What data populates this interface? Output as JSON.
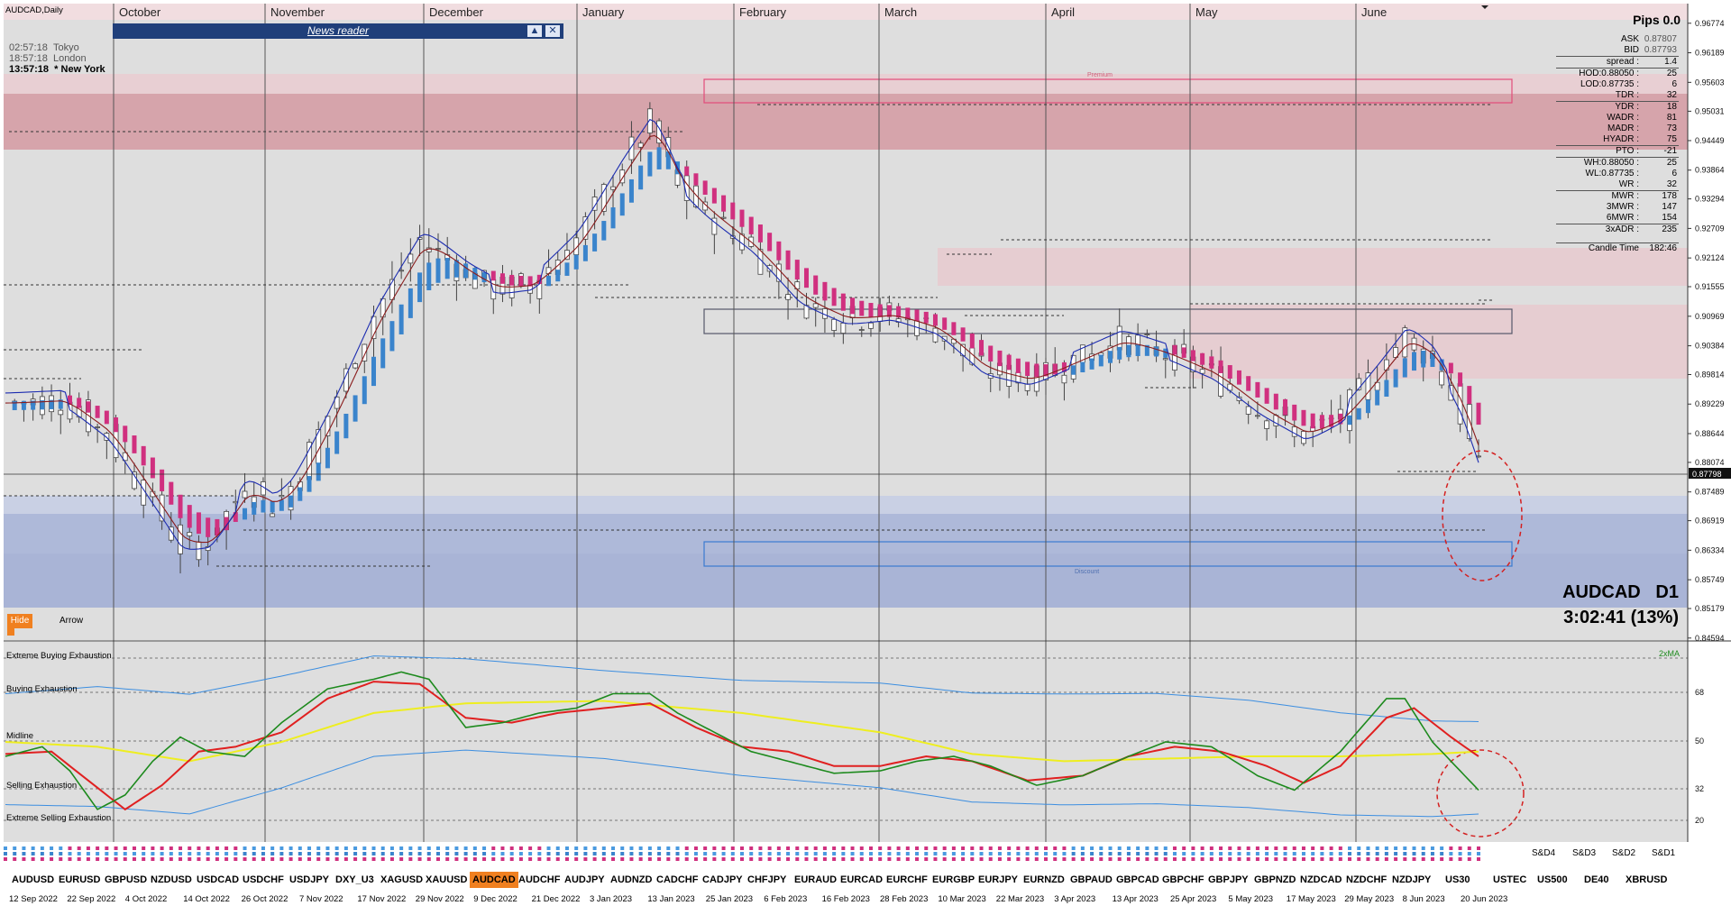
{
  "window": {
    "title": "AUDCAD,Daily"
  },
  "months": [
    "October",
    "November",
    "December",
    "January",
    "February",
    "March",
    "April",
    "May",
    "June"
  ],
  "news_reader": {
    "title": "News reader"
  },
  "clocks": [
    {
      "time": "02:57:18",
      "city": "Tokyo"
    },
    {
      "time": "18:57:18",
      "city": "London"
    },
    {
      "time": "13:57:18",
      "city": "* New York"
    }
  ],
  "info": {
    "pips": "Pips 0.0",
    "rows": [
      {
        "label": "ASK",
        "value": "0.87807"
      },
      {
        "label": "BID",
        "value": "0.87793"
      },
      {
        "label": "spread :",
        "value": "1.4"
      },
      {
        "label": "HOD:0.88050 :",
        "value": "25"
      },
      {
        "label": "LOD:0.87735 :",
        "value": "6"
      },
      {
        "label": "TDR :",
        "value": "32"
      },
      {
        "label": "YDR :",
        "value": "18"
      },
      {
        "label": "WADR :",
        "value": "81"
      },
      {
        "label": "MADR :",
        "value": "73"
      },
      {
        "label": "HYADR :",
        "value": "75"
      },
      {
        "label": "PTO :",
        "value": "-21"
      },
      {
        "label": "WH:0.88050 :",
        "value": "25"
      },
      {
        "label": "WL:0.87735 :",
        "value": "6"
      },
      {
        "label": "WR :",
        "value": "32"
      },
      {
        "label": "MWR :",
        "value": "178"
      },
      {
        "label": "3MWR :",
        "value": "147"
      },
      {
        "label": "6MWR :",
        "value": "154"
      },
      {
        "label": "3xADR :",
        "value": "235"
      },
      {
        "label": "Candle Time",
        "value": "182:46"
      }
    ]
  },
  "symbol_title": "AUDCAD   D1",
  "timer": "3:02:41 (13%)",
  "zone_labels": {
    "premium": "Premium",
    "discount": "Discount"
  },
  "controls": {
    "hide": "Hide",
    "arrow": "Arrow"
  },
  "indicator": {
    "labels": [
      "Extreme Buying Exhaustion",
      "Buying Exhaustion",
      "Midline",
      "Selling Exhaustion",
      "Extreme Selling Exhaustion"
    ],
    "tag": "2xMA",
    "levels": [
      "68",
      "50",
      "32",
      "20"
    ]
  },
  "strength_labels": [
    "S&D4",
    "S&D3",
    "S&D2",
    "S&D1"
  ],
  "symbols": [
    "AUDUSD",
    "EURUSD",
    "GBPUSD",
    "NZDUSD",
    "USDCAD",
    "USDCHF",
    "USDJPY",
    "DXY_U3",
    "XAGUSD",
    "XAUUSD",
    "AUDCAD",
    "AUDCHF",
    "AUDJPY",
    "AUDNZD",
    "CADCHF",
    "CADJPY",
    "CHFJPY",
    "EURAUD",
    "EURCAD",
    "EURCHF",
    "EURGBP",
    "EURJPY",
    "EURNZD",
    "GBPAUD",
    "GBPCAD",
    "GBPCHF",
    "GBPJPY",
    "GBPNZD",
    "NZDCAD",
    "NZDCHF",
    "NZDJPY",
    "US30",
    "USTEC",
    "US500",
    "DE40",
    "XBRUSD"
  ],
  "active_symbol": "AUDCAD",
  "dates": [
    "12 Sep 2022",
    "22 Sep 2022",
    "4 Oct 2022",
    "14 Oct 2022",
    "26 Oct 2022",
    "7 Nov 2022",
    "17 Nov 2022",
    "29 Nov 2022",
    "9 Dec 2022",
    "21 Dec 2022",
    "3 Jan 2023",
    "13 Jan 2023",
    "25 Jan 2023",
    "6 Feb 2023",
    "16 Feb 2023",
    "28 Feb 2023",
    "10 Mar 2023",
    "22 Mar 2023",
    "3 Apr 2023",
    "13 Apr 2023",
    "25 Apr 2023",
    "5 May 2023",
    "17 May 2023",
    "29 May 2023",
    "8 Jun 2023",
    "20 Jun 2023"
  ],
  "colors": {
    "premium_zone": "#d49aa2",
    "discount_zone": "#a7b4d6",
    "bull_band": "#3a84cc",
    "bear_band": "#d0307f",
    "green_line": "#1d8a1d",
    "red_line": "#e02020",
    "yellow_line": "#eeee20",
    "blue_band": "#3c8ee0"
  },
  "chart_data": {
    "type": "line",
    "symbol": "AUDCAD",
    "timeframe": "Daily",
    "y_ticks": [
      "0.96774",
      "0.96189",
      "0.95603",
      "0.95031",
      "0.94449",
      "0.93864",
      "0.93294",
      "0.92709",
      "0.92124",
      "0.91555",
      "0.90969",
      "0.90384",
      "0.89814",
      "0.89229",
      "0.88644",
      "0.88074",
      "0.87489",
      "0.86919",
      "0.86334",
      "0.85749",
      "0.85179",
      "0.84594"
    ],
    "current_price": "0.87798",
    "ylim": [
      0.8459,
      0.9677
    ],
    "price_path": [
      [
        0,
        0.8925
      ],
      [
        12,
        0.893
      ],
      [
        22,
        0.886
      ],
      [
        30,
        0.875
      ],
      [
        38,
        0.864
      ],
      [
        44,
        0.865
      ],
      [
        52,
        0.876
      ],
      [
        58,
        0.872
      ],
      [
        62,
        0.876
      ],
      [
        70,
        0.89
      ],
      [
        80,
        0.91
      ],
      [
        90,
        0.925
      ],
      [
        100,
        0.918
      ],
      [
        106,
        0.915
      ],
      [
        114,
        0.916
      ],
      [
        124,
        0.925
      ],
      [
        134,
        0.94
      ],
      [
        140,
        0.948
      ],
      [
        146,
        0.935
      ],
      [
        152,
        0.93
      ],
      [
        162,
        0.923
      ],
      [
        172,
        0.913
      ],
      [
        182,
        0.909
      ],
      [
        192,
        0.91
      ],
      [
        202,
        0.907
      ],
      [
        212,
        0.899
      ],
      [
        222,
        0.897
      ],
      [
        232,
        0.901
      ],
      [
        242,
        0.905
      ],
      [
        252,
        0.902
      ],
      [
        262,
        0.898
      ],
      [
        272,
        0.891
      ],
      [
        282,
        0.886
      ],
      [
        290,
        0.89
      ],
      [
        298,
        0.899
      ],
      [
        304,
        0.906
      ],
      [
        310,
        0.901
      ],
      [
        316,
        0.89
      ],
      [
        320,
        0.879
      ]
    ],
    "indicator_green": [
      [
        0,
        44
      ],
      [
        8,
        48
      ],
      [
        14,
        38
      ],
      [
        20,
        22
      ],
      [
        26,
        28
      ],
      [
        32,
        42
      ],
      [
        38,
        52
      ],
      [
        44,
        46
      ],
      [
        52,
        44
      ],
      [
        60,
        58
      ],
      [
        70,
        72
      ],
      [
        80,
        76
      ],
      [
        86,
        79
      ],
      [
        92,
        76
      ],
      [
        100,
        56
      ],
      [
        108,
        58
      ],
      [
        116,
        62
      ],
      [
        124,
        64
      ],
      [
        132,
        70
      ],
      [
        140,
        70
      ],
      [
        146,
        62
      ],
      [
        154,
        54
      ],
      [
        162,
        46
      ],
      [
        170,
        42
      ],
      [
        180,
        37
      ],
      [
        190,
        38
      ],
      [
        198,
        42
      ],
      [
        206,
        44
      ],
      [
        214,
        40
      ],
      [
        224,
        32
      ],
      [
        234,
        36
      ],
      [
        244,
        44
      ],
      [
        252,
        50
      ],
      [
        262,
        48
      ],
      [
        272,
        36
      ],
      [
        280,
        30
      ],
      [
        290,
        46
      ],
      [
        300,
        68
      ],
      [
        304,
        68
      ],
      [
        310,
        50
      ],
      [
        316,
        38
      ],
      [
        320,
        30
      ]
    ],
    "indicator_red": [
      [
        0,
        45
      ],
      [
        10,
        46
      ],
      [
        18,
        34
      ],
      [
        26,
        22
      ],
      [
        34,
        32
      ],
      [
        42,
        46
      ],
      [
        50,
        48
      ],
      [
        60,
        54
      ],
      [
        70,
        68
      ],
      [
        80,
        75
      ],
      [
        90,
        74
      ],
      [
        100,
        60
      ],
      [
        110,
        58
      ],
      [
        120,
        62
      ],
      [
        130,
        64
      ],
      [
        140,
        66
      ],
      [
        150,
        56
      ],
      [
        160,
        48
      ],
      [
        170,
        46
      ],
      [
        180,
        40
      ],
      [
        190,
        40
      ],
      [
        200,
        44
      ],
      [
        210,
        42
      ],
      [
        222,
        34
      ],
      [
        234,
        36
      ],
      [
        244,
        44
      ],
      [
        254,
        48
      ],
      [
        264,
        46
      ],
      [
        274,
        40
      ],
      [
        282,
        33
      ],
      [
        290,
        40
      ],
      [
        300,
        60
      ],
      [
        306,
        64
      ],
      [
        314,
        52
      ],
      [
        320,
        44
      ]
    ],
    "indicator_yellow": [
      [
        0,
        50
      ],
      [
        20,
        48
      ],
      [
        40,
        42
      ],
      [
        60,
        50
      ],
      [
        80,
        62
      ],
      [
        100,
        66
      ],
      [
        130,
        67
      ],
      [
        160,
        62
      ],
      [
        190,
        54
      ],
      [
        210,
        45
      ],
      [
        230,
        42
      ],
      [
        250,
        43
      ],
      [
        270,
        44
      ],
      [
        290,
        44
      ],
      [
        310,
        45
      ],
      [
        320,
        46
      ]
    ]
  }
}
